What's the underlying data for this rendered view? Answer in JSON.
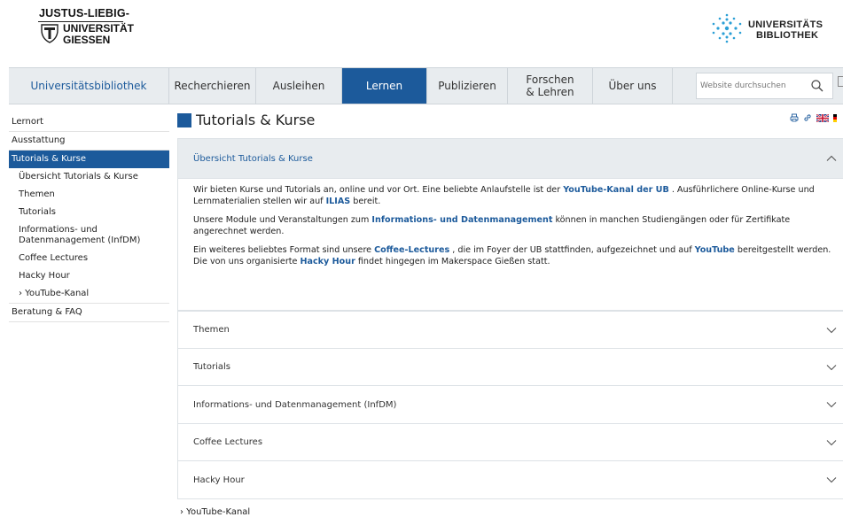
{
  "header": {
    "jlu_logo": {
      "line1": "JUSTUS-LIEBIG-",
      "line2": "UNIVERSITÄT",
      "line3": "GIESSEN"
    },
    "ub_logo": {
      "line1": "UNIVERSITÄTS",
      "line2": "BIBLIOTHEK"
    }
  },
  "nav": {
    "home": "Universitätsbibliothek",
    "items": [
      {
        "label": "Recherchieren"
      },
      {
        "label": "Ausleihen"
      },
      {
        "label": "Lernen"
      },
      {
        "label": "Publizieren"
      },
      {
        "label": "Forschen & Lehren"
      },
      {
        "label": "Über uns"
      }
    ],
    "active_index": 2
  },
  "search": {
    "placeholder": "Website durchsuchen",
    "icon": "search-icon"
  },
  "sidebar": {
    "items": [
      {
        "label": "Lernort"
      },
      {
        "label": "Ausstattung"
      },
      {
        "label": "Tutorials & Kurse"
      }
    ],
    "subitems": [
      {
        "label": "Übersicht Tutorials & Kurse"
      },
      {
        "label": "Themen"
      },
      {
        "label": "Tutorials"
      },
      {
        "label": "Informations- und Datenmanagement (InfDM)"
      },
      {
        "label": "Coffee Lectures"
      },
      {
        "label": "Hacky Hour"
      },
      {
        "label": "› YouTube-Kanal"
      }
    ],
    "after": [
      {
        "label": "Beratung & FAQ"
      }
    ]
  },
  "main": {
    "title": "Tutorials & Kurse",
    "tools": {
      "print_icon": "print-icon",
      "link_icon": "link-icon",
      "flags": [
        "uk-flag-icon",
        "de-flag-icon"
      ]
    },
    "open_section": {
      "title": "Übersicht Tutorials & Kurse",
      "p1": {
        "t1": "Wir bieten Kurse und Tutorials an, online und vor Ort. Eine beliebte Anlaufstelle ist der ",
        "l1": "YouTube-Kanal der UB",
        "t2": " . Ausführlichere Online-Kurse und Lernmaterialien stellen wir auf ",
        "l2": "ILIAS",
        "t3": " bereit."
      },
      "p2": {
        "t1": "Unsere Module und Veranstaltungen zum ",
        "l1": "Informations- und Datenmanagement",
        "t2": " können in manchen Studiengängen oder für Zertifikate angerechnet werden."
      },
      "p3": {
        "t1": "Ein weiteres beliebtes Format sind unsere ",
        "l1": "Coffee-Lectures",
        "t2": " , die im Foyer der UB stattfinden, aufgezeichnet und auf ",
        "l2": "YouTube",
        "t3": " bereitgestellt werden. Die von uns organisierte ",
        "l3": "Hacky Hour",
        "t4": " findet hingegen im Makerspace Gießen statt."
      }
    },
    "sections": [
      {
        "title": "Themen"
      },
      {
        "title": "Tutorials"
      },
      {
        "title": "Informations- und Datenmanagement (InfDM)"
      },
      {
        "title": "Coffee Lectures"
      },
      {
        "title": "Hacky Hour"
      }
    ],
    "youtube_link": "› YouTube-Kanal"
  },
  "colors": {
    "brand_blue": "#1c5a9b",
    "nav_bg": "#e8ecef"
  }
}
